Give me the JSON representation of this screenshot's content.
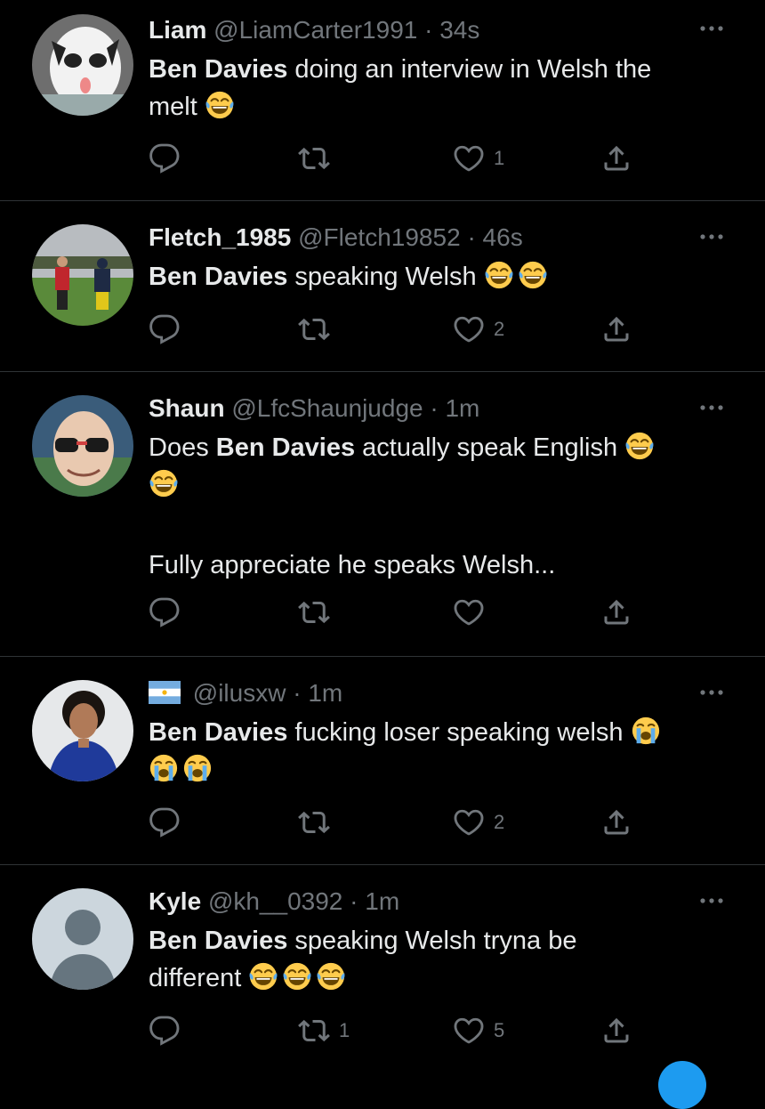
{
  "tweets": [
    {
      "name": "Liam",
      "handle": "@LiamCarter1991",
      "time": "34s",
      "bold": "Ben Davies",
      "text_lines": [
        " doing an interview in Welsh the",
        "melt "
      ],
      "emojis": [
        "joy"
      ],
      "replies": "",
      "retweets": "",
      "likes": "1"
    },
    {
      "name": "Fletch_1985",
      "handle": "@Fletch19852",
      "time": "46s",
      "bold": "Ben Davies",
      "text_lines": [
        " speaking Welsh "
      ],
      "emojis": [
        "joy",
        "joy"
      ],
      "replies": "",
      "retweets": "",
      "likes": "2"
    },
    {
      "name": "Shaun",
      "handle": "@LfcShaunjudge",
      "time": "1m",
      "prefix": "Does ",
      "bold": "Ben Davies",
      "text_lines": [
        " actually speak English "
      ],
      "second_paragraph": "Fully appreciate he speaks Welsh...",
      "emojis": [
        "joy",
        "joy"
      ],
      "replies": "",
      "retweets": "",
      "likes": ""
    },
    {
      "name": "",
      "flag": "argentina-flag-icon",
      "handle": "@ilusxw",
      "time": "1m",
      "bold": "Ben Davies",
      "text_lines": [
        " fucking loser speaking welsh "
      ],
      "emojis": [
        "sob",
        "sob",
        "sob"
      ],
      "replies": "",
      "retweets": "",
      "likes": "2"
    },
    {
      "name": "Kyle",
      "handle": "@kh__0392",
      "time": "1m",
      "bold": "Ben Davies",
      "text_lines": [
        " speaking Welsh tryna be",
        "different "
      ],
      "emojis": [
        "joy",
        "joy",
        "joy"
      ],
      "replies": "",
      "retweets": "1",
      "likes": "5"
    }
  ],
  "separator": "·",
  "colors": {
    "background": "#000000",
    "text": "#e7e9ea",
    "muted": "#71767b",
    "divider": "#2f3336"
  }
}
